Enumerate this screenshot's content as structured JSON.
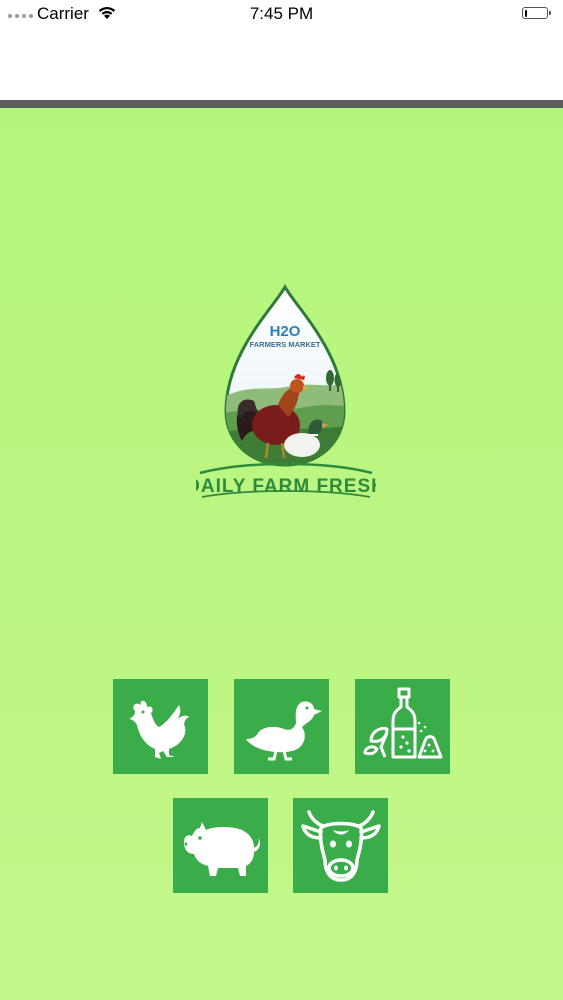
{
  "status_bar": {
    "carrier": "Carrier",
    "time": "7:45 PM",
    "battery_level": 0.12
  },
  "logo": {
    "brand_h2o": "H2O",
    "brand_sub": "FARMERS MARKET",
    "tagline": "DAILY FARM FRESH",
    "icon": "rooster-duck-drop-logo"
  },
  "categories": [
    {
      "id": "chicken",
      "icon": "chicken-icon"
    },
    {
      "id": "duck",
      "icon": "duck-icon"
    },
    {
      "id": "grocery",
      "icon": "oil-bottle-spice-icon"
    },
    {
      "id": "pig",
      "icon": "pig-icon"
    },
    {
      "id": "cow",
      "icon": "cow-icon"
    }
  ],
  "colors": {
    "background": "#b8f580",
    "tile": "#3aad4a",
    "nav_divider": "#5b5e5a",
    "tagline": "#2e8b3a"
  }
}
